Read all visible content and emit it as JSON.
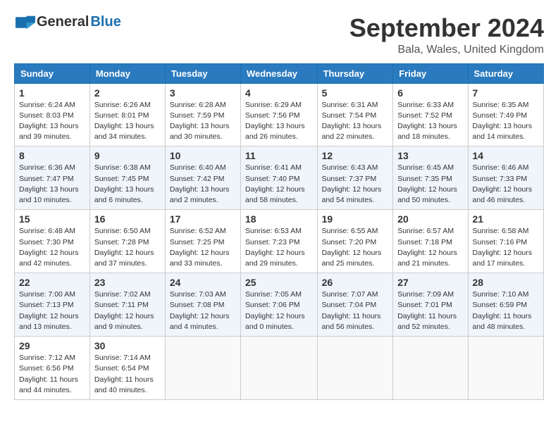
{
  "logo": {
    "general": "General",
    "blue": "Blue"
  },
  "title": {
    "month_year": "September 2024",
    "location": "Bala, Wales, United Kingdom"
  },
  "calendar": {
    "headers": [
      "Sunday",
      "Monday",
      "Tuesday",
      "Wednesday",
      "Thursday",
      "Friday",
      "Saturday"
    ],
    "weeks": [
      [
        {
          "day": "",
          "empty": true
        },
        {
          "day": "",
          "empty": true
        },
        {
          "day": "",
          "empty": true
        },
        {
          "day": "",
          "empty": true
        },
        {
          "day": "5",
          "sunrise": "6:31 AM",
          "sunset": "7:54 PM",
          "daylight": "13 hours and 22 minutes."
        },
        {
          "day": "6",
          "sunrise": "6:33 AM",
          "sunset": "7:52 PM",
          "daylight": "13 hours and 18 minutes."
        },
        {
          "day": "7",
          "sunrise": "6:35 AM",
          "sunset": "7:49 PM",
          "daylight": "13 hours and 14 minutes."
        }
      ],
      [
        {
          "day": "1",
          "sunrise": "6:24 AM",
          "sunset": "8:03 PM",
          "daylight": "13 hours and 39 minutes."
        },
        {
          "day": "2",
          "sunrise": "6:26 AM",
          "sunset": "8:01 PM",
          "daylight": "13 hours and 34 minutes."
        },
        {
          "day": "3",
          "sunrise": "6:28 AM",
          "sunset": "7:59 PM",
          "daylight": "13 hours and 30 minutes."
        },
        {
          "day": "4",
          "sunrise": "6:29 AM",
          "sunset": "7:56 PM",
          "daylight": "13 hours and 26 minutes."
        },
        {
          "day": "5",
          "sunrise": "6:31 AM",
          "sunset": "7:54 PM",
          "daylight": "13 hours and 22 minutes."
        },
        {
          "day": "6",
          "sunrise": "6:33 AM",
          "sunset": "7:52 PM",
          "daylight": "13 hours and 18 minutes."
        },
        {
          "day": "7",
          "sunrise": "6:35 AM",
          "sunset": "7:49 PM",
          "daylight": "13 hours and 14 minutes."
        }
      ],
      [
        {
          "day": "8",
          "sunrise": "6:36 AM",
          "sunset": "7:47 PM",
          "daylight": "13 hours and 10 minutes."
        },
        {
          "day": "9",
          "sunrise": "6:38 AM",
          "sunset": "7:45 PM",
          "daylight": "13 hours and 6 minutes."
        },
        {
          "day": "10",
          "sunrise": "6:40 AM",
          "sunset": "7:42 PM",
          "daylight": "13 hours and 2 minutes."
        },
        {
          "day": "11",
          "sunrise": "6:41 AM",
          "sunset": "7:40 PM",
          "daylight": "12 hours and 58 minutes."
        },
        {
          "day": "12",
          "sunrise": "6:43 AM",
          "sunset": "7:37 PM",
          "daylight": "12 hours and 54 minutes."
        },
        {
          "day": "13",
          "sunrise": "6:45 AM",
          "sunset": "7:35 PM",
          "daylight": "12 hours and 50 minutes."
        },
        {
          "day": "14",
          "sunrise": "6:46 AM",
          "sunset": "7:33 PM",
          "daylight": "12 hours and 46 minutes."
        }
      ],
      [
        {
          "day": "15",
          "sunrise": "6:48 AM",
          "sunset": "7:30 PM",
          "daylight": "12 hours and 42 minutes."
        },
        {
          "day": "16",
          "sunrise": "6:50 AM",
          "sunset": "7:28 PM",
          "daylight": "12 hours and 37 minutes."
        },
        {
          "day": "17",
          "sunrise": "6:52 AM",
          "sunset": "7:25 PM",
          "daylight": "12 hours and 33 minutes."
        },
        {
          "day": "18",
          "sunrise": "6:53 AM",
          "sunset": "7:23 PM",
          "daylight": "12 hours and 29 minutes."
        },
        {
          "day": "19",
          "sunrise": "6:55 AM",
          "sunset": "7:20 PM",
          "daylight": "12 hours and 25 minutes."
        },
        {
          "day": "20",
          "sunrise": "6:57 AM",
          "sunset": "7:18 PM",
          "daylight": "12 hours and 21 minutes."
        },
        {
          "day": "21",
          "sunrise": "6:58 AM",
          "sunset": "7:16 PM",
          "daylight": "12 hours and 17 minutes."
        }
      ],
      [
        {
          "day": "22",
          "sunrise": "7:00 AM",
          "sunset": "7:13 PM",
          "daylight": "12 hours and 13 minutes."
        },
        {
          "day": "23",
          "sunrise": "7:02 AM",
          "sunset": "7:11 PM",
          "daylight": "12 hours and 9 minutes."
        },
        {
          "day": "24",
          "sunrise": "7:03 AM",
          "sunset": "7:08 PM",
          "daylight": "12 hours and 4 minutes."
        },
        {
          "day": "25",
          "sunrise": "7:05 AM",
          "sunset": "7:06 PM",
          "daylight": "12 hours and 0 minutes."
        },
        {
          "day": "26",
          "sunrise": "7:07 AM",
          "sunset": "7:04 PM",
          "daylight": "11 hours and 56 minutes."
        },
        {
          "day": "27",
          "sunrise": "7:09 AM",
          "sunset": "7:01 PM",
          "daylight": "11 hours and 52 minutes."
        },
        {
          "day": "28",
          "sunrise": "7:10 AM",
          "sunset": "6:59 PM",
          "daylight": "11 hours and 48 minutes."
        }
      ],
      [
        {
          "day": "29",
          "sunrise": "7:12 AM",
          "sunset": "6:56 PM",
          "daylight": "11 hours and 44 minutes."
        },
        {
          "day": "30",
          "sunrise": "7:14 AM",
          "sunset": "6:54 PM",
          "daylight": "11 hours and 40 minutes."
        },
        {
          "day": "",
          "empty": true
        },
        {
          "day": "",
          "empty": true
        },
        {
          "day": "",
          "empty": true
        },
        {
          "day": "",
          "empty": true
        },
        {
          "day": "",
          "empty": true
        }
      ]
    ]
  }
}
